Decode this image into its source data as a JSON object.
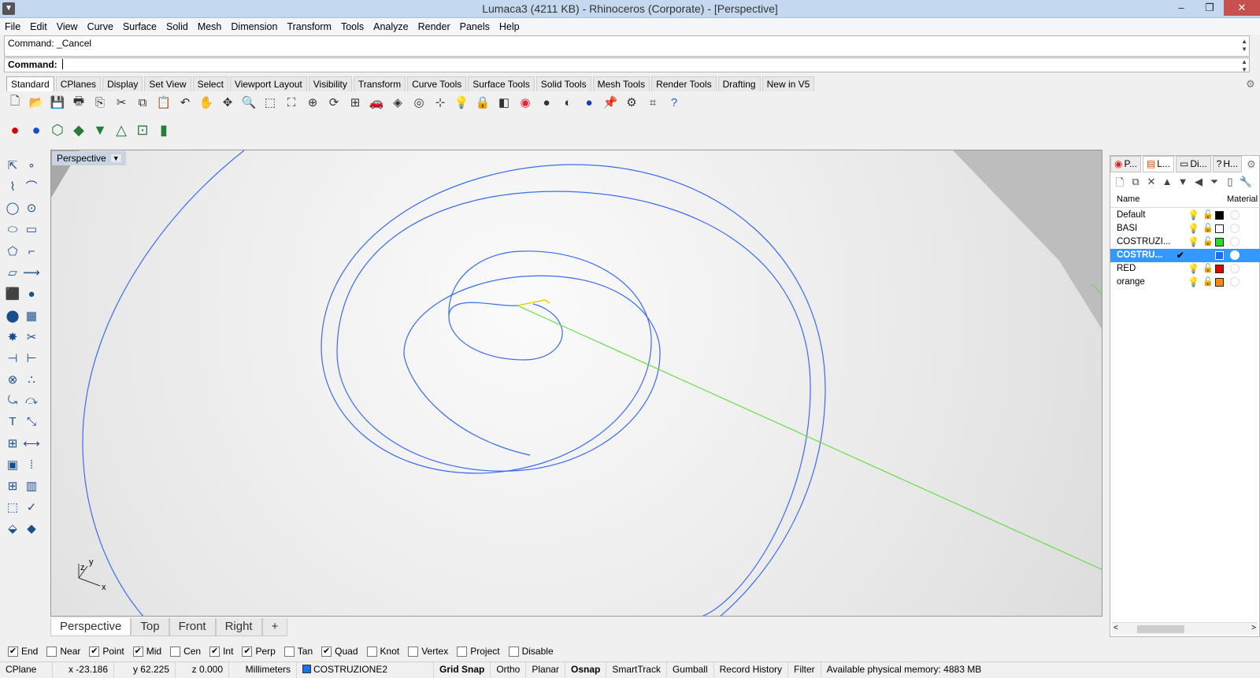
{
  "window": {
    "title": "Lumaca3 (4211 KB) - Rhinoceros (Corporate) - [Perspective]",
    "minimize": "–",
    "restore": "❐",
    "close": "✕"
  },
  "menu": [
    "File",
    "Edit",
    "View",
    "Curve",
    "Surface",
    "Solid",
    "Mesh",
    "Dimension",
    "Transform",
    "Tools",
    "Analyze",
    "Render",
    "Panels",
    "Help"
  ],
  "command": {
    "history": "Command: _Cancel",
    "prompt": "Command:",
    "value": ""
  },
  "toolbar_tabs": [
    "Standard",
    "CPlanes",
    "Display",
    "Set View",
    "Select",
    "Viewport Layout",
    "Visibility",
    "Transform",
    "Curve Tools",
    "Surface Tools",
    "Solid Tools",
    "Mesh Tools",
    "Render Tools",
    "Drafting",
    "New in V5"
  ],
  "toolbar1_icons": [
    "new-icon",
    "open-icon",
    "save-icon",
    "print-icon",
    "import-icon",
    "cut-icon",
    "copy-icon",
    "paste-icon",
    "undo-icon",
    "pan-icon",
    "move-view-icon",
    "zoom-icon",
    "zoom-window-icon",
    "zoom-extents-icon",
    "zoom-selected-icon",
    "rotate-view-icon",
    "four-viewports-icon",
    "car-icon",
    "render-preview-icon",
    "circle-tool-icon",
    "snap-icon",
    "light-icon",
    "lock-icon",
    "layer-icon",
    "color-wheel-icon",
    "sphere-grey-icon",
    "sphere-shaded-icon",
    "sphere-blue-icon",
    "pin-icon",
    "settings-icon",
    "grid-snap-icon",
    "help-icon"
  ],
  "toolbar2_icons": [
    "red-sphere-icon",
    "blue-sphere-icon",
    "ghosted-icon",
    "xray-icon",
    "technical-icon",
    "pen-icon",
    "points-icon",
    "artistic-icon"
  ],
  "left_tools": [
    "select-icon",
    "point-icon",
    "polyline-icon",
    "curve-icon",
    "circle-icon",
    "arc-icon",
    "ellipse-icon",
    "rectangle-icon",
    "polygon-icon",
    "fillet-icon",
    "surface-icon",
    "sweep-icon",
    "box-icon",
    "sphere-icon",
    "cylinder-icon",
    "mesh-icon",
    "explode-icon",
    "split-icon",
    "trim-icon",
    "extend-icon",
    "boolean-icon",
    "points-group-icon",
    "offset-icon",
    "blend-icon",
    "text-icon",
    "scale-icon",
    "group-icon",
    "dimension-icon",
    "block-icon",
    "array-icon",
    "grid-icon",
    "hatch-icon",
    "analyze-icon",
    "check-icon",
    "material-icon",
    "render-icon"
  ],
  "viewport": {
    "label": "Perspective",
    "axes": {
      "x": "x",
      "y": "y",
      "z": "z"
    }
  },
  "viewport_tabs": [
    "Perspective",
    "Top",
    "Front",
    "Right",
    "+"
  ],
  "osnap": [
    {
      "label": "End",
      "checked": true
    },
    {
      "label": "Near",
      "checked": false
    },
    {
      "label": "Point",
      "checked": true
    },
    {
      "label": "Mid",
      "checked": true
    },
    {
      "label": "Cen",
      "checked": false
    },
    {
      "label": "Int",
      "checked": true
    },
    {
      "label": "Perp",
      "checked": true
    },
    {
      "label": "Tan",
      "checked": false
    },
    {
      "label": "Quad",
      "checked": true
    },
    {
      "label": "Knot",
      "checked": false
    },
    {
      "label": "Vertex",
      "checked": false
    },
    {
      "label": "Project",
      "checked": false
    },
    {
      "label": "Disable",
      "checked": false
    }
  ],
  "status": {
    "cplane": "CPlane",
    "x": "x -23.186",
    "y": "y 62.225",
    "z": "z 0.000",
    "units": "Millimeters",
    "layer": "COSTRUZIONE2",
    "layer_color": "#1a6ef5",
    "toggles": [
      {
        "label": "Grid Snap",
        "bold": true
      },
      {
        "label": "Ortho",
        "bold": false
      },
      {
        "label": "Planar",
        "bold": false
      },
      {
        "label": "Osnap",
        "bold": true
      },
      {
        "label": "SmartTrack",
        "bold": false
      },
      {
        "label": "Gumball",
        "bold": false
      },
      {
        "label": "Record History",
        "bold": false
      },
      {
        "label": "Filter",
        "bold": false
      }
    ],
    "memory": "Available physical memory: 4883 MB"
  },
  "panel": {
    "tabs": [
      "P...",
      "L...",
      "Di...",
      "H..."
    ],
    "tab_icons": [
      "color-wheel-icon",
      "layers-icon",
      "display-icon",
      "help-icon"
    ],
    "tools": [
      "new-layer-icon",
      "new-sublayer-icon",
      "delete-icon",
      "move-up-icon",
      "move-down-icon",
      "move-parent-icon",
      "filter-icon",
      "page-icon",
      "tools-icon"
    ],
    "header": {
      "name": "Name",
      "material": "Material"
    },
    "layers": [
      {
        "name": "Default",
        "color": "#000000",
        "current": false
      },
      {
        "name": "BASI",
        "color": "#ffffff",
        "current": false
      },
      {
        "name": "COSTRUZI...",
        "color": "#22dd22",
        "current": false
      },
      {
        "name": "COSTRU...",
        "color": "#1a6ef5",
        "current": true,
        "check": "✔"
      },
      {
        "name": "RED",
        "color": "#e00000",
        "current": false
      },
      {
        "name": "orange",
        "color": "#ff8800",
        "current": false
      }
    ]
  }
}
